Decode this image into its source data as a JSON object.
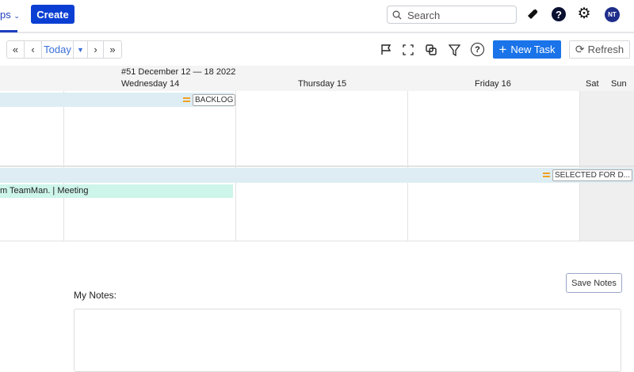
{
  "header": {
    "nav_fragment": "ps",
    "create_label": "Create",
    "search_placeholder": "Search",
    "avatar_initials": "NT"
  },
  "toolbar": {
    "today_label": "Today",
    "new_task_label": "New Task",
    "refresh_label": "Refresh"
  },
  "calendar": {
    "week_label": "#51 December 12 — 18 2022",
    "days": [
      "Wednesday 14",
      "Thursday 15",
      "Friday 16",
      "Sat",
      "Sun"
    ],
    "lanes": [
      {
        "tag": "BACKLOG"
      },
      {
        "tag": "SELECTED FOR D..."
      }
    ],
    "event": "m TeamMan. | Meeting"
  },
  "notes": {
    "label": "My Notes:",
    "save_label": "Save Notes",
    "value": ""
  },
  "colors": {
    "primary": "#0b3fd3",
    "accent": "#1a73e8",
    "lane": "#deedf4",
    "event": "#cdf5e9"
  }
}
